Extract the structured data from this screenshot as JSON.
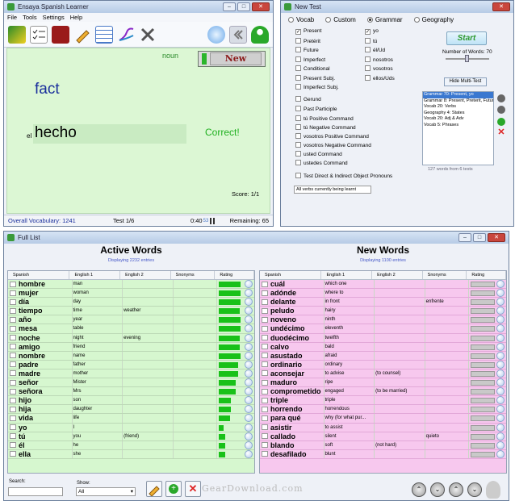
{
  "learner": {
    "title": "Ensaya Spanish Learner",
    "menu": [
      "File",
      "Tools",
      "Settings",
      "Help"
    ],
    "part_of_speech": "noun",
    "new_label": "New",
    "prompt_word": "fact",
    "article": "el",
    "answer": "hecho",
    "feedback": "Correct!",
    "score": "Score: 1/1",
    "status": {
      "vocabulary": "Overall Vocabulary: 1241",
      "test": "Test 1/6",
      "timer": "0:40",
      "timer_extra": "53",
      "remaining": "Remaining: 65"
    }
  },
  "newtest": {
    "title": "New Test",
    "tabs": [
      {
        "label": "Vocab",
        "selected": false
      },
      {
        "label": "Custom",
        "selected": false
      },
      {
        "label": "Grammar",
        "selected": true
      },
      {
        "label": "Geography",
        "selected": false
      }
    ],
    "tenses": [
      {
        "label": "Present",
        "checked": true
      },
      {
        "label": "Pretérit",
        "checked": false
      },
      {
        "label": "Future",
        "checked": false
      },
      {
        "label": "Imperfect",
        "checked": false
      },
      {
        "label": "Conditional",
        "checked": false
      },
      {
        "label": "Present Subj.",
        "checked": false
      },
      {
        "label": "Imperfect Subj.",
        "checked": false
      }
    ],
    "persons": [
      {
        "label": "yo",
        "checked": true
      },
      {
        "label": "tú",
        "checked": false
      },
      {
        "label": "él/Ud",
        "checked": false
      },
      {
        "label": "nosotros",
        "checked": false
      },
      {
        "label": "vosotros",
        "checked": false
      },
      {
        "label": "ellos/Uds",
        "checked": false
      }
    ],
    "forms": [
      {
        "label": "Gerund",
        "checked": false
      },
      {
        "label": "Past Participle",
        "checked": false
      }
    ],
    "commands": [
      {
        "label": "tú Positive Command",
        "checked": false
      },
      {
        "label": "tú Negative Command",
        "checked": false
      },
      {
        "label": "vosotros Positive Command",
        "checked": false
      },
      {
        "label": "vosotros Negative Command",
        "checked": false
      },
      {
        "label": "usted Command",
        "checked": false
      },
      {
        "label": "ustedes Command",
        "checked": false
      }
    ],
    "pronouns_option": "Test Direct & Indirect Object Pronouns",
    "verb_filter": "All verbs currently being learnt",
    "start_label": "Start",
    "number_of_words": "Number of Words: 70",
    "hide_multi": "Hide Multi-Test",
    "multi_tests": [
      {
        "label": "Grammar 70: Present, yo",
        "selected": true
      },
      {
        "label": "Grammar 8: Present, Preterit, Future",
        "selected": false
      },
      {
        "label": "Vocab 20: Verbs",
        "selected": false
      },
      {
        "label": "Geography 4: States",
        "selected": false
      },
      {
        "label": "Vocab 20: Adj & Adv",
        "selected": false
      },
      {
        "label": "Vocab 5: Phrases",
        "selected": false
      }
    ],
    "multi_note": "127 words from 6 tests"
  },
  "fulllist": {
    "title": "Full List",
    "active": {
      "heading": "Active Words",
      "count": "Displaying 2232 entries",
      "columns": [
        "Spanish",
        "English 1",
        "English 2",
        "Snonyms",
        "Rating"
      ],
      "rows": [
        {
          "es": "hombre",
          "en1": "man",
          "en2": "",
          "syn": "",
          "rating": 0.9
        },
        {
          "es": "mujer",
          "en1": "woman",
          "en2": "",
          "syn": "",
          "rating": 0.9
        },
        {
          "es": "día",
          "en1": "day",
          "en2": "",
          "syn": "",
          "rating": 0.9
        },
        {
          "es": "tiempo",
          "en1": "time",
          "en2": "weather",
          "syn": "",
          "rating": 0.85
        },
        {
          "es": "año",
          "en1": "year",
          "en2": "",
          "syn": "",
          "rating": 0.9
        },
        {
          "es": "mesa",
          "en1": "table",
          "en2": "",
          "syn": "",
          "rating": 0.9
        },
        {
          "es": "noche",
          "en1": "night",
          "en2": "evening",
          "syn": "",
          "rating": 0.85
        },
        {
          "es": "amigo",
          "en1": "friend",
          "en2": "",
          "syn": "",
          "rating": 0.85
        },
        {
          "es": "nombre",
          "en1": "name",
          "en2": "",
          "syn": "",
          "rating": 0.9
        },
        {
          "es": "padre",
          "en1": "father",
          "en2": "",
          "syn": "",
          "rating": 0.8
        },
        {
          "es": "madre",
          "en1": "mother",
          "en2": "",
          "syn": "",
          "rating": 0.8
        },
        {
          "es": "señor",
          "en1": "Mister",
          "en2": "",
          "syn": "",
          "rating": 0.7
        },
        {
          "es": "señora",
          "en1": "Mrs",
          "en2": "",
          "syn": "",
          "rating": 0.7
        },
        {
          "es": "hijo",
          "en1": "son",
          "en2": "",
          "syn": "",
          "rating": 0.5
        },
        {
          "es": "hija",
          "en1": "daughter",
          "en2": "",
          "syn": "",
          "rating": 0.5
        },
        {
          "es": "vida",
          "en1": "life",
          "en2": "",
          "syn": "",
          "rating": 0.45
        },
        {
          "es": "yo",
          "en1": "I",
          "en2": "",
          "syn": "",
          "rating": 0.2
        },
        {
          "es": "tú",
          "en1": "you",
          "en2": "(friend)",
          "syn": "",
          "rating": 0.25
        },
        {
          "es": "él",
          "en1": "he",
          "en2": "",
          "syn": "",
          "rating": 0.25
        },
        {
          "es": "ella",
          "en1": "she",
          "en2": "",
          "syn": "",
          "rating": 0.25
        }
      ]
    },
    "new": {
      "heading": "New Words",
      "count": "Displaying 1100 entries",
      "columns": [
        "Spanish",
        "English 1",
        "English 2",
        "Snonyms",
        "Rating"
      ],
      "rows": [
        {
          "es": "cuál",
          "en1": "which one",
          "en2": "",
          "syn": ""
        },
        {
          "es": "adónde",
          "en1": "where to",
          "en2": "",
          "syn": ""
        },
        {
          "es": "delante",
          "en1": "in front",
          "en2": "",
          "syn": "enfrente"
        },
        {
          "es": "peludo",
          "en1": "hairy",
          "en2": "",
          "syn": ""
        },
        {
          "es": "noveno",
          "en1": "ninth",
          "en2": "",
          "syn": ""
        },
        {
          "es": "undécimo",
          "en1": "eleventh",
          "en2": "",
          "syn": ""
        },
        {
          "es": "duodécimo",
          "en1": "twelfth",
          "en2": "",
          "syn": ""
        },
        {
          "es": "calvo",
          "en1": "bald",
          "en2": "",
          "syn": ""
        },
        {
          "es": "asustado",
          "en1": "afraid",
          "en2": "",
          "syn": ""
        },
        {
          "es": "ordinario",
          "en1": "ordinary",
          "en2": "",
          "syn": ""
        },
        {
          "es": "aconsejar",
          "en1": "to advise",
          "en2": "(to counsel)",
          "syn": ""
        },
        {
          "es": "maduro",
          "en1": "ripe",
          "en2": "",
          "syn": ""
        },
        {
          "es": "comprometido",
          "en1": "engaged",
          "en2": "(to be married)",
          "syn": ""
        },
        {
          "es": "triple",
          "en1": "triple",
          "en2": "",
          "syn": ""
        },
        {
          "es": "horrendo",
          "en1": "horrendous",
          "en2": "",
          "syn": ""
        },
        {
          "es": "para qué",
          "en1": "why (for what pur...",
          "en2": "",
          "syn": ""
        },
        {
          "es": "asistir",
          "en1": "to assist",
          "en2": "",
          "syn": ""
        },
        {
          "es": "callado",
          "en1": "silent",
          "en2": "",
          "syn": "quieto"
        },
        {
          "es": "blando",
          "en1": "soft",
          "en2": "(not hard)",
          "syn": ""
        },
        {
          "es": "desafilado",
          "en1": "blunt",
          "en2": "",
          "syn": ""
        }
      ]
    },
    "search_label": "Search:",
    "search_value": "",
    "show_label": "Show:",
    "show_value": "All"
  },
  "watermark": "GearDownload.com",
  "colors": {
    "active_bg": "#d6f7cf",
    "new_bg": "#f7c8ee",
    "rating_green": "#19c119",
    "brand_green": "#2e9a2e"
  }
}
